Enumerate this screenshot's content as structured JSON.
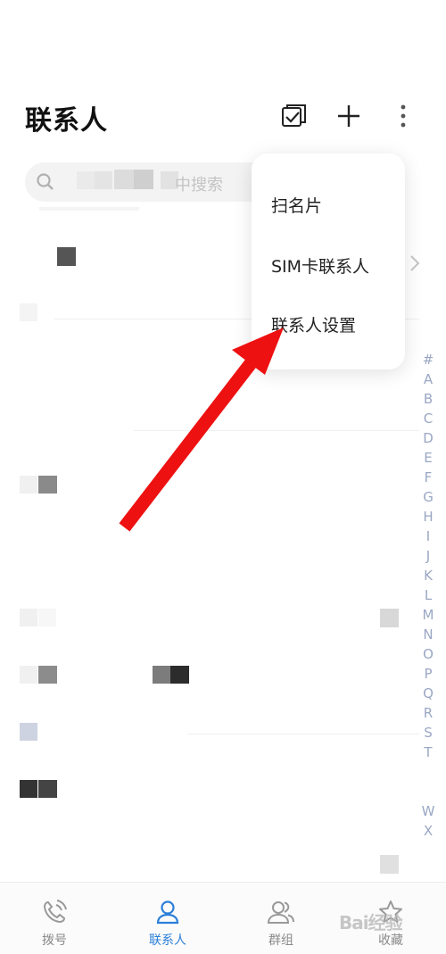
{
  "header": {
    "title": "联系人",
    "icons": {
      "multi_select": "multi-select-checkbox-icon",
      "add": "plus-icon",
      "more": "more-vertical-icon"
    }
  },
  "search": {
    "placeholder_visible": "中搜索"
  },
  "popup_menu": {
    "items": [
      {
        "label": "扫名片"
      },
      {
        "label": "SIM卡联系人"
      },
      {
        "label": "联系人设置"
      }
    ]
  },
  "alphabet_index": [
    "#",
    "A",
    "B",
    "C",
    "D",
    "E",
    "F",
    "G",
    "H",
    "I",
    "J",
    "K",
    "L",
    "M",
    "N",
    "O",
    "P",
    "Q",
    "R",
    "S",
    "T",
    "",
    "",
    "W",
    "X",
    ""
  ],
  "bottom_nav": {
    "tabs": [
      {
        "label": "拨号",
        "icon": "phone-icon",
        "active": false
      },
      {
        "label": "联系人",
        "icon": "person-icon",
        "active": true
      },
      {
        "label": "群组",
        "icon": "group-icon",
        "active": false
      },
      {
        "label": "收藏",
        "icon": "star-icon",
        "active": false
      }
    ]
  },
  "watermark": "Bai经验",
  "colors": {
    "accent": "#2b7fd9",
    "arrow": "#ee1111",
    "index": "#9aa7c4"
  }
}
